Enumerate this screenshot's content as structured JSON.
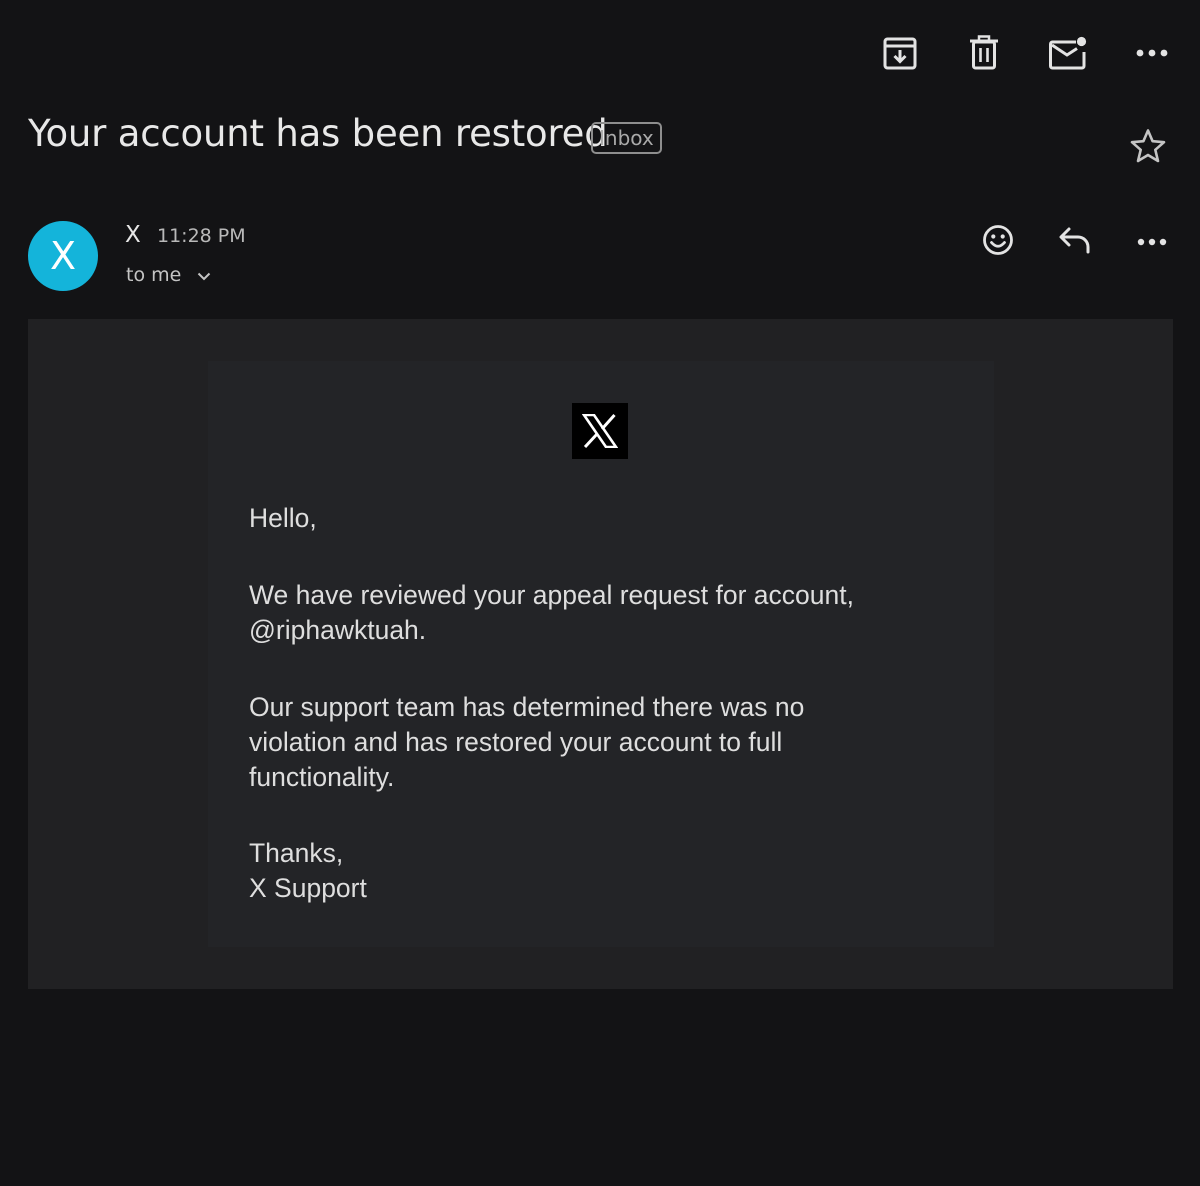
{
  "toolbar": {
    "icons": [
      "archive-icon",
      "delete-icon",
      "mark-unread-icon",
      "more-icon"
    ]
  },
  "email": {
    "subject": "Your account has been restored",
    "label": "Inbox",
    "sender": {
      "avatar_letter": "X",
      "name": "X",
      "time": "11:28 PM",
      "recipient": "to me",
      "avatar_color": "#14b4da"
    },
    "body": {
      "greeting": "Hello,",
      "paragraph1": [
        "We have reviewed your appeal request for account,",
        "@riphawktuah."
      ],
      "paragraph2": [
        "Our support team has determined there was no",
        "violation and has restored your account to full",
        "functionality."
      ],
      "signoff": "Thanks,",
      "signature": "X Support"
    }
  },
  "colors": {
    "background": "#131315",
    "body_frame": "#212123",
    "card": "#232427",
    "text": "#dedede"
  }
}
